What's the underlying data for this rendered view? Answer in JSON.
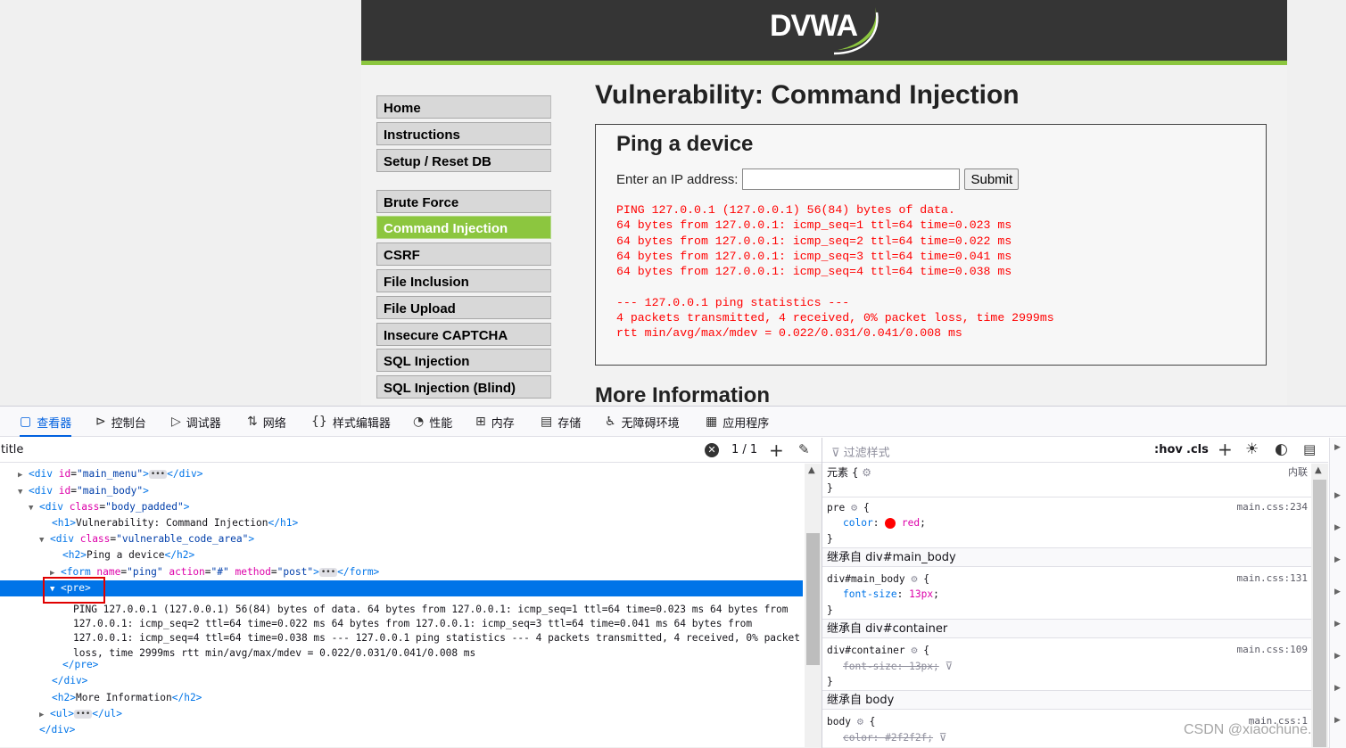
{
  "dvwa": {
    "logo_text": "DVWA",
    "menu_group1": [
      "Home",
      "Instructions",
      "Setup / Reset DB"
    ],
    "menu_group2": [
      "Brute Force",
      "Command Injection",
      "CSRF",
      "File Inclusion",
      "File Upload",
      "Insecure CAPTCHA",
      "SQL Injection",
      "SQL Injection (Blind)"
    ],
    "selected_menu": "Command Injection",
    "page_title": "Vulnerability: Command Injection",
    "vuln_heading": "Ping a device",
    "ip_label": "Enter an IP address:",
    "ip_value": "",
    "submit_label": "Submit",
    "ping_output": "PING 127.0.0.1 (127.0.0.1) 56(84) bytes of data.\n64 bytes from 127.0.0.1: icmp_seq=1 ttl=64 time=0.023 ms\n64 bytes from 127.0.0.1: icmp_seq=2 ttl=64 time=0.022 ms\n64 bytes from 127.0.0.1: icmp_seq=3 ttl=64 time=0.041 ms\n64 bytes from 127.0.0.1: icmp_seq=4 ttl=64 time=0.038 ms\n\n--- 127.0.0.1 ping statistics ---\n4 packets transmitted, 4 received, 0% packet loss, time 2999ms\nrtt min/avg/max/mdev = 0.022/0.031/0.041/0.008 ms",
    "more_info": "More Information",
    "colors": {
      "accent": "#8cc63f",
      "header": "#353535",
      "output": "#ff0000"
    }
  },
  "devtools": {
    "tabs": [
      {
        "label": "查看器",
        "icon": "inspector-icon",
        "glyph": "▢",
        "active": true
      },
      {
        "label": "控制台",
        "icon": "console-icon",
        "glyph": "⊳",
        "active": false
      },
      {
        "label": "调试器",
        "icon": "debugger-icon",
        "glyph": "▷",
        "active": false
      },
      {
        "label": "网络",
        "icon": "network-icon",
        "glyph": "⇅",
        "active": false
      },
      {
        "label": "样式编辑器",
        "icon": "style-editor-icon",
        "glyph": "{}",
        "active": false
      },
      {
        "label": "性能",
        "icon": "performance-icon",
        "glyph": "◔",
        "active": false
      },
      {
        "label": "内存",
        "icon": "memory-icon",
        "glyph": "⊞",
        "active": false
      },
      {
        "label": "存储",
        "icon": "storage-icon",
        "glyph": "▤",
        "active": false
      },
      {
        "label": "无障碍环境",
        "icon": "accessibility-icon",
        "glyph": "♿",
        "active": false
      },
      {
        "label": "应用程序",
        "icon": "application-icon",
        "glyph": "▦",
        "active": false
      }
    ],
    "search_value": "title",
    "search_count": "1 / 1",
    "markup": {
      "main_menu": {
        "tag": "div",
        "attr": "id",
        "val": "main_menu"
      },
      "main_body": {
        "tag": "div",
        "attr": "id",
        "val": "main_body"
      },
      "body_padded": {
        "tag": "div",
        "attr": "class",
        "val": "body_padded"
      },
      "h1_text": "Vulnerability: Command Injection",
      "vuln_area": {
        "tag": "div",
        "attr": "class",
        "val": "vulnerable_code_area"
      },
      "h2_text": "Ping a device",
      "form": {
        "name": "ping",
        "action": "#",
        "method": "post"
      },
      "pre_tag": "<pre>",
      "pre_text": "PING 127.0.0.1 (127.0.0.1) 56(84) bytes of data. 64 bytes from 127.0.0.1: icmp_seq=1 ttl=64 time=0.023 ms 64 bytes from 127.0.0.1: icmp_seq=2 ttl=64 time=0.022 ms 64 bytes from 127.0.0.1: icmp_seq=3 ttl=64 time=0.041 ms 64 bytes from 127.0.0.1: icmp_seq=4 ttl=64 time=0.038 ms --- 127.0.0.1 ping statistics --- 4 packets transmitted, 4 received, 0% packet loss, time 2999ms rtt min/avg/max/mdev = 0.022/0.031/0.041/0.008 ms",
      "close_pre": "</pre>",
      "close_div": "</div>",
      "h2_more": "More Information",
      "ul_tag": "ul"
    },
    "rules": {
      "filter_placeholder": "过滤样式",
      "hov": ":hov",
      "cls": ".cls",
      "element_label": "元素",
      "inline_label": "内联",
      "pre_selector": "pre",
      "pre_source": "main.css:234",
      "pre_prop": "color",
      "pre_value": "red",
      "inherit_main_body": "继承自 div#main_body",
      "main_body_selector": "div#main_body",
      "main_body_source": "main.css:131",
      "main_body_prop": "font-size",
      "main_body_value": "13px",
      "inherit_container": "继承自 div#container",
      "container_selector": "div#container",
      "container_source": "main.css:109",
      "container_decl": "font-size: 13px;",
      "inherit_body": "继承自 body",
      "body_selector": "body",
      "body_source": "main.css:1",
      "body_decl": "color: #2f2f2f;"
    }
  },
  "watermark": "CSDN @xiaochune."
}
